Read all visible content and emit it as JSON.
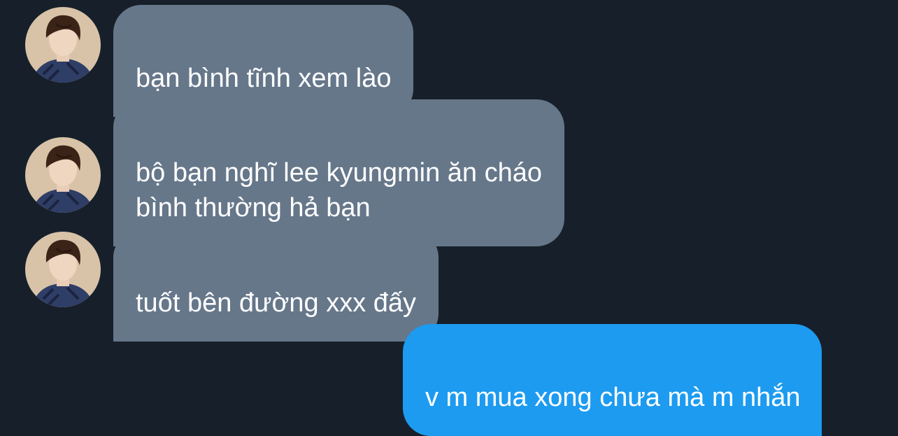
{
  "messages": [
    {
      "direction": "incoming",
      "text": "bạn bình tĩnh xem lào"
    },
    {
      "direction": "incoming",
      "text": "bộ bạn nghĩ lee kyungmin ăn cháo\nbình thường hả bạn"
    },
    {
      "direction": "incoming",
      "text": "tuốt bên đường xxx đấy"
    },
    {
      "direction": "outgoing",
      "text": "v m mua xong chưa mà m nhắn"
    }
  ],
  "colors": {
    "background": "#17202a",
    "incoming_bubble": "#66778a",
    "outgoing_bubble": "#1d9bf0",
    "text": "#ffffff"
  },
  "icons": {
    "avatar": "contact-avatar-photo"
  }
}
